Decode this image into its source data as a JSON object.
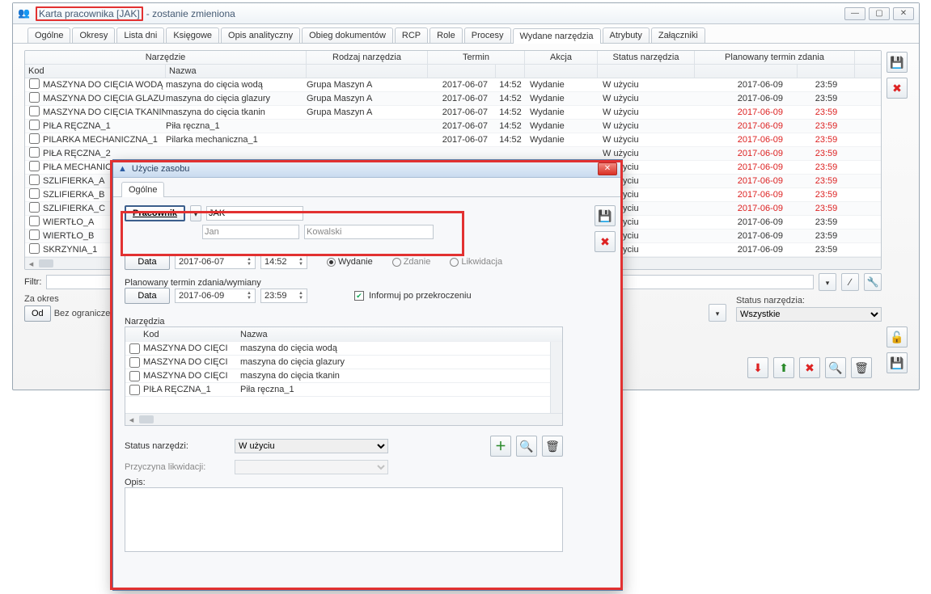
{
  "window": {
    "title_prefix": "Karta pracownika [JAK]",
    "title_suffix": "- zostanie zmieniona",
    "minimize": "—",
    "maximize": "▢",
    "close": "✕"
  },
  "tabs": [
    "Ogólne",
    "Okresy",
    "Lista dni",
    "Księgowe",
    "Opis analityczny",
    "Obieg dokumentów",
    "RCP",
    "Role",
    "Procesy",
    "Wydane narzędzia",
    "Atrybuty",
    "Załączniki"
  ],
  "headers": {
    "tool": "Narzędzie",
    "kod": "Kod",
    "nazwa": "Nazwa",
    "type": "Rodzaj narzędzia",
    "date": "Termin",
    "action": "Akcja",
    "status": "Status narzędzia",
    "planned": "Planowany termin zdania"
  },
  "rows": [
    {
      "kod": "MASZYNA DO CIĘCIA WODĄ",
      "nazwa": "maszyna do cięcia wodą",
      "type": "Grupa Maszyn A",
      "dd": "2017-06-07",
      "dt": "14:52",
      "action": "Wydanie",
      "status": "W użyciu",
      "pd": "2017-06-09",
      "pt": "23:59",
      "red": false
    },
    {
      "kod": "MASZYNA DO CIĘCIA GLAZURY",
      "nazwa": "maszyna do cięcia glazury",
      "type": "Grupa Maszyn A",
      "dd": "2017-06-07",
      "dt": "14:52",
      "action": "Wydanie",
      "status": "W użyciu",
      "pd": "2017-06-09",
      "pt": "23:59",
      "red": false
    },
    {
      "kod": "MASZYNA DO CIĘCIA TKANIN",
      "nazwa": "maszyna do cięcia tkanin",
      "type": "Grupa Maszyn A",
      "dd": "2017-06-07",
      "dt": "14:52",
      "action": "Wydanie",
      "status": "W użyciu",
      "pd": "2017-06-09",
      "pt": "23:59",
      "red": true
    },
    {
      "kod": "PIŁA RĘCZNA_1",
      "nazwa": "Piła ręczna_1",
      "type": "",
      "dd": "2017-06-07",
      "dt": "14:52",
      "action": "Wydanie",
      "status": "W użyciu",
      "pd": "2017-06-09",
      "pt": "23:59",
      "red": true
    },
    {
      "kod": "PILARKA MECHANICZNA_1",
      "nazwa": "Pilarka mechaniczna_1",
      "type": "",
      "dd": "2017-06-07",
      "dt": "14:52",
      "action": "Wydanie",
      "status": "W użyciu",
      "pd": "2017-06-09",
      "pt": "23:59",
      "red": true
    },
    {
      "kod": "PIŁA RĘCZNA_2",
      "nazwa": "",
      "type": "",
      "dd": "",
      "dt": "",
      "action": "",
      "status": "W użyciu",
      "pd": "2017-06-09",
      "pt": "23:59",
      "red": true
    },
    {
      "kod": "PIŁA MECHANICZNA",
      "nazwa": "",
      "type": "",
      "dd": "",
      "dt": "",
      "action": "",
      "status": "W użyciu",
      "pd": "2017-06-09",
      "pt": "23:59",
      "red": true
    },
    {
      "kod": "SZLIFIERKA_A",
      "nazwa": "",
      "type": "",
      "dd": "",
      "dt": "",
      "action": "",
      "status": "W użyciu",
      "pd": "2017-06-09",
      "pt": "23:59",
      "red": true
    },
    {
      "kod": "SZLIFIERKA_B",
      "nazwa": "",
      "type": "",
      "dd": "",
      "dt": "",
      "action": "",
      "status": "W użyciu",
      "pd": "2017-06-09",
      "pt": "23:59",
      "red": true
    },
    {
      "kod": "SZLIFIERKA_C",
      "nazwa": "",
      "type": "",
      "dd": "",
      "dt": "",
      "action": "",
      "status": "W użyciu",
      "pd": "2017-06-09",
      "pt": "23:59",
      "red": true
    },
    {
      "kod": "WIERTŁO_A",
      "nazwa": "",
      "type": "",
      "dd": "",
      "dt": "",
      "action": "",
      "status": "W użyciu",
      "pd": "2017-06-09",
      "pt": "23:59",
      "red": false
    },
    {
      "kod": "WIERTŁO_B",
      "nazwa": "",
      "type": "",
      "dd": "",
      "dt": "",
      "action": "",
      "status": "W użyciu",
      "pd": "2017-06-09",
      "pt": "23:59",
      "red": false
    },
    {
      "kod": "SKRZYNIA_1",
      "nazwa": "",
      "type": "",
      "dd": "",
      "dt": "",
      "action": "",
      "status": "W użyciu",
      "pd": "2017-06-09",
      "pt": "23:59",
      "red": false
    }
  ],
  "filter": {
    "label": "Filtr:",
    "za_okres": "Za okres",
    "od": "Od",
    "bez_ogranicz": "Bez ograniczeń",
    "status_label": "Status narzędzia:",
    "status_value": "Wszystkie"
  },
  "side_icons": {
    "save": "💾",
    "delete": "✖",
    "lock": "🔓",
    "save2": "💾"
  },
  "action_icons": {
    "export": "⬇",
    "import": "⬆",
    "del": "✖",
    "search": "🔍",
    "trash": "🗑"
  },
  "dialog": {
    "title": "Użycie zasobu",
    "tab": "Ogólne",
    "pracownik_btn": "Pracownik",
    "pracownik_code": "JAK",
    "first_name": "Jan",
    "last_name": "Kowalski",
    "data_btn": "Data",
    "date1": "2017-06-07",
    "time1": "14:52",
    "radio_wydanie": "Wydanie",
    "radio_zdanie": "Zdanie",
    "radio_likwidacja": "Likwidacja",
    "planned_label": "Planowany termin zdania/wymiany",
    "date2": "2017-06-09",
    "time2": "23:59",
    "inform_label": "Informuj po przekroczeniu",
    "narzedzia_label": "Narzędzia",
    "kod_h": "Kod",
    "nazwa_h": "Nazwa",
    "drows": [
      {
        "kod": "MASZYNA DO CIĘCI",
        "nazwa": "maszyna do cięcia wodą"
      },
      {
        "kod": "MASZYNA DO CIĘCI",
        "nazwa": "maszyna do cięcia glazury"
      },
      {
        "kod": "MASZYNA DO CIĘCI",
        "nazwa": "maszyna do cięcia tkanin"
      },
      {
        "kod": "PIŁA RĘCZNA_1",
        "nazwa": "Piła ręczna_1"
      }
    ],
    "status_label": "Status narzędzi:",
    "status_value": "W użyciu",
    "reason_label": "Przyczyna likwidacji:",
    "opis_label": "Opis:",
    "side": {
      "save": "💾",
      "delete": "✖"
    },
    "tool_icons": {
      "add": "＋",
      "search": "🔍",
      "trash": "🗑"
    }
  }
}
